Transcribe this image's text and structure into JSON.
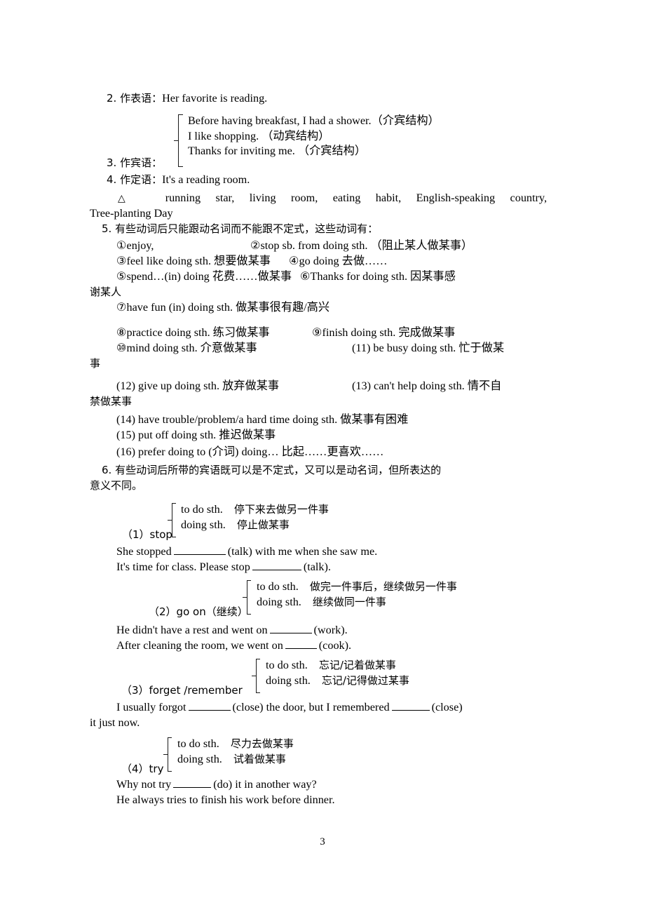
{
  "document": {
    "page_number": "3",
    "sections": {
      "item2": {
        "label": "2. 作表语：",
        "text": "Her favorite is reading."
      },
      "item3": {
        "label": "3. 作宾语：",
        "examples": [
          "Before having breakfast, I had a shower.（介宾结构）",
          "I like shopping. （动宾结构）",
          "Thanks for inviting me. （介宾结构）"
        ]
      },
      "item4": {
        "label": "4. 作定语：",
        "text": "It's a reading room."
      },
      "triangle_note": {
        "marker": "△",
        "line1": "running star, living room, eating habit, English-speaking country,",
        "line2": "Tree-planting Day"
      },
      "item5": {
        "heading": "5. 有些动词后只能跟动名词而不能跟不定式，这些动词有：",
        "entries": [
          {
            "left": "①enjoy,",
            "right": "②stop sb. from doing sth. （阻止某人做某事）"
          },
          {
            "left": "③feel like doing sth. 想要做某事",
            "right": "④go doing  去做……"
          },
          {
            "left": "⑤spend…(in) doing  花费……做某事",
            "right": "⑥Thanks for doing sth. 因某事感"
          }
        ],
        "wrap1": "谢某人",
        "entry7": "⑦have fun (in) doing sth. 做某事很有趣/高兴",
        "entries2": [
          {
            "left": "⑧practice doing sth. 练习做某事",
            "right": "⑨finish doing sth. 完成做某事"
          },
          {
            "left": "⑩mind doing sth. 介意做某事",
            "right": "(11) be busy doing sth. 忙于做某"
          }
        ],
        "wrap2": "事",
        "entries3": [
          {
            "left": "(12) give up doing sth. 放弃做某事",
            "right": "(13) can't help doing sth. 情不自"
          }
        ],
        "wrap3": "禁做某事",
        "entry14": "(14) have trouble/problem/a hard time doing sth. 做某事有困难",
        "entry15": "(15) put off doing sth. 推迟做某事",
        "entry16": "(16) prefer doing to (介词) doing… 比起……更喜欢……"
      },
      "item6": {
        "heading_line1": "6. 有些动词后所带的宾语既可以是不定式，又可以是动名词，但所表达的",
        "heading_line2": "意义不同。",
        "groups": [
          {
            "label": "（1）stop",
            "rows": [
              {
                "en": "to do sth.",
                "zh": "停下来去做另一件事"
              },
              {
                "en": "doing sth.",
                "zh": "停止做某事"
              }
            ],
            "sentences": [
              {
                "pre": "She stopped",
                "blank_w": 74,
                "post": "(talk) with me when she saw me."
              },
              {
                "pre": "It's time for class. Please stop",
                "blank_w": 70,
                "post": "(talk)."
              }
            ]
          },
          {
            "label": "（2）go on（继续）",
            "rows": [
              {
                "en": "to do sth.",
                "zh": "做完一件事后，继续做另一件事"
              },
              {
                "en": "doing sth.",
                "zh": "继续做同一件事"
              }
            ],
            "sentences": [
              {
                "pre": "He didn't have a rest and went on",
                "blank_w": 60,
                "post": "(work)."
              },
              {
                "pre": "After cleaning the room, we went on",
                "blank_w": 45,
                "post": "(cook)."
              }
            ]
          },
          {
            "label": "（3）forget /remember",
            "rows": [
              {
                "en": "to do sth.",
                "zh": "忘记/记着做某事"
              },
              {
                "en": "doing sth.",
                "zh": "忘记/记得做过某事"
              }
            ],
            "sentences": [
              {
                "pre": "I usually forgot",
                "blank_w": 60,
                "mid": "(close) the door, but I remembered",
                "blank2_w": 54,
                "post": "(close)"
              }
            ],
            "wrap": "it just now."
          },
          {
            "label": "（4）try",
            "rows": [
              {
                "en": "to do sth.",
                "zh": "尽力去做某事"
              },
              {
                "en": "doing sth.",
                "zh": "试着做某事"
              }
            ],
            "sentences": [
              {
                "pre": "Why not try",
                "blank_w": 54,
                "post": "(do) it in another way?"
              },
              {
                "plain": "He always tries to finish his work before dinner."
              }
            ]
          }
        ]
      }
    }
  }
}
